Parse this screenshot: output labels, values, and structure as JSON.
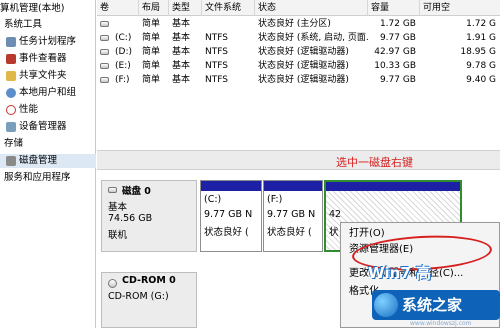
{
  "tree": {
    "root": "算机管理(本地)",
    "items": [
      {
        "label": "系统工具",
        "icon": "tools-icon"
      },
      {
        "label": "任务计划程序",
        "icon": "task-scheduler-icon"
      },
      {
        "label": "事件查看器",
        "icon": "event-viewer-icon"
      },
      {
        "label": "共享文件夹",
        "icon": "shared-folder-icon"
      },
      {
        "label": "本地用户和组",
        "icon": "users-icon"
      },
      {
        "label": "性能",
        "icon": "performance-icon"
      },
      {
        "label": "设备管理器",
        "icon": "device-manager-icon"
      },
      {
        "label": "存储",
        "icon": ""
      },
      {
        "label": "磁盘管理",
        "icon": "disk-management-icon"
      },
      {
        "label": "服务和应用程序",
        "icon": ""
      }
    ]
  },
  "volumes": {
    "headers": [
      "卷",
      "布局",
      "类型",
      "文件系统",
      "状态",
      "容量",
      "可用空"
    ],
    "rows": [
      {
        "vol": "",
        "layout": "简单",
        "type": "基本",
        "fs": "",
        "status": "状态良好 (主分区)",
        "capacity": "1.72 GB",
        "free": "1.72 G"
      },
      {
        "vol": "(C:)",
        "layout": "简单",
        "type": "基本",
        "fs": "NTFS",
        "status": "状态良好 (系统, 启动, 页面...",
        "capacity": "9.77 GB",
        "free": "1.91 G"
      },
      {
        "vol": "(D:)",
        "layout": "简单",
        "type": "基本",
        "fs": "NTFS",
        "status": "状态良好 (逻辑驱动器)",
        "capacity": "42.97 GB",
        "free": "18.95 G"
      },
      {
        "vol": "(E:)",
        "layout": "简单",
        "type": "基本",
        "fs": "NTFS",
        "status": "状态良好 (逻辑驱动器)",
        "capacity": "10.33 GB",
        "free": "9.78 G"
      },
      {
        "vol": "(F:)",
        "layout": "简单",
        "type": "基本",
        "fs": "NTFS",
        "status": "状态良好 (逻辑驱动器)",
        "capacity": "9.77 GB",
        "free": "9.40 G"
      }
    ]
  },
  "disk0": {
    "name": "磁盘 0",
    "type": "基本",
    "size": "74.56 GB",
    "state": "联机",
    "partitions": [
      {
        "name": "(C:)",
        "size": "9.77 GB N",
        "status": "状态良好 ("
      },
      {
        "name": "(F:)",
        "size": "9.77 GB N",
        "status": "状态良好 ("
      },
      {
        "name": "",
        "size": "42",
        "status": "状"
      }
    ]
  },
  "cdrom0": {
    "name": "CD-ROM 0",
    "drive": "CD-ROM (G:)"
  },
  "annotation": "选中一磁盘右键",
  "context_menu": {
    "items": [
      "打开(O)",
      "资源管理器(E)",
      "更改驱动器号和路径(C)...",
      "格式化"
    ]
  },
  "watermark": {
    "win7": "Win7 高",
    "logo_text": "系统之家",
    "url": "www.windowszj.com"
  },
  "colors": {
    "partition_bar": "#1d1fa4",
    "annotation_red": "#d6201f",
    "selection_green": "#2f8d2f"
  }
}
